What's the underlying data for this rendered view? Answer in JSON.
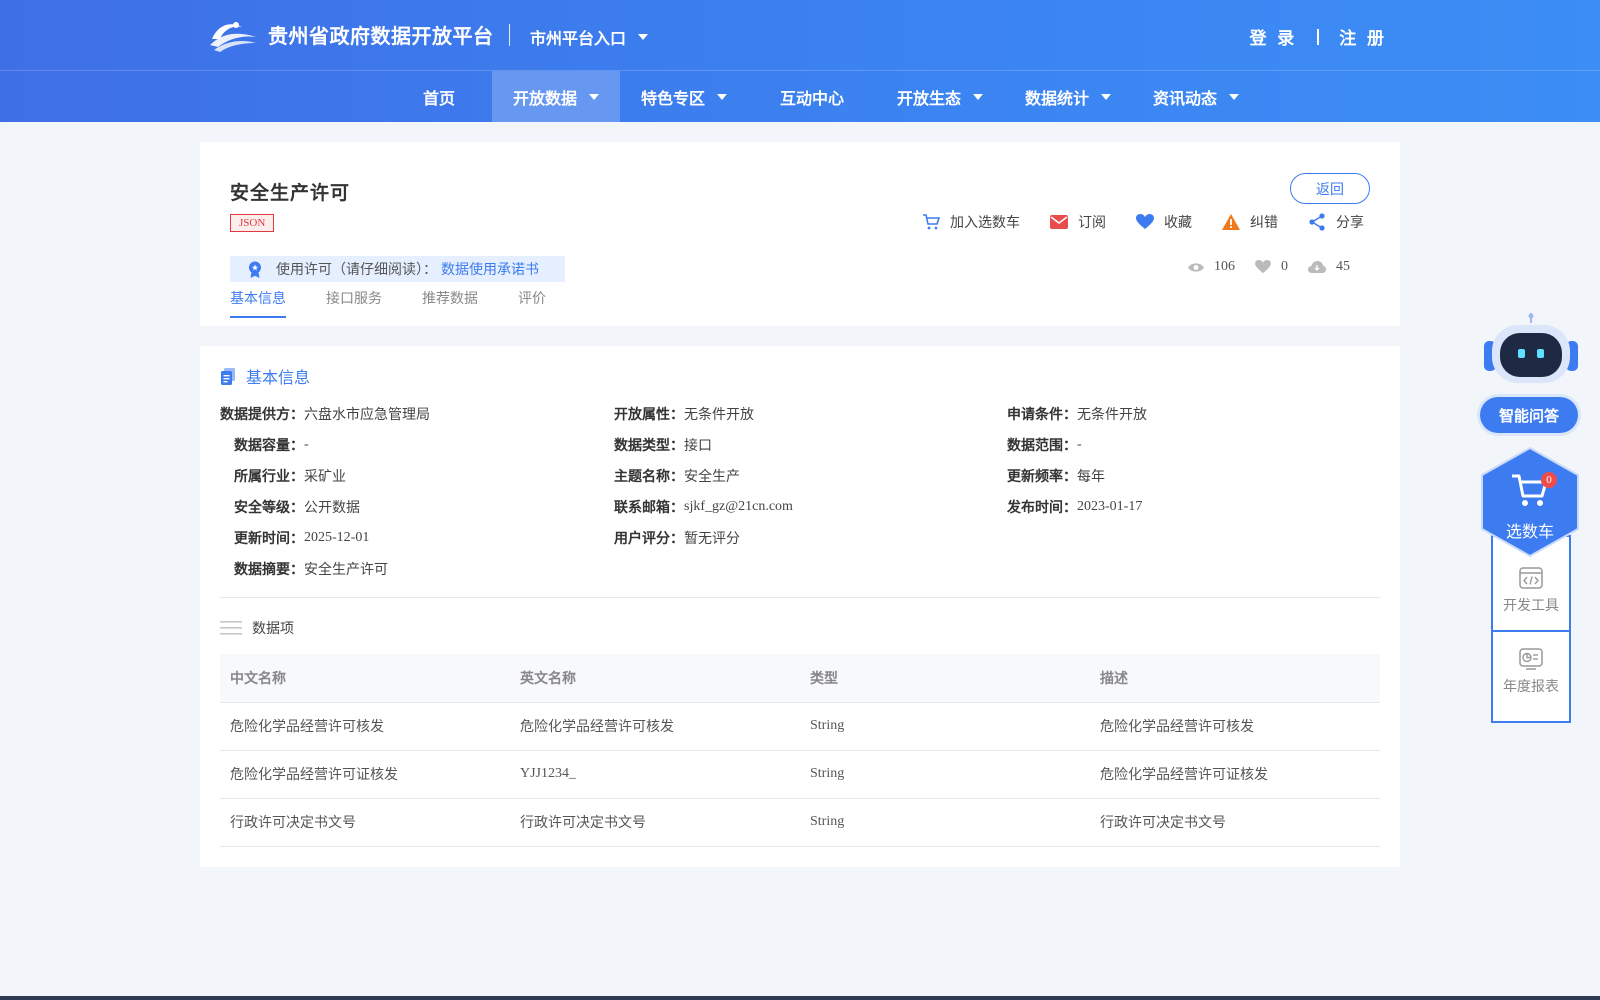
{
  "header": {
    "site_title": "贵州省政府数据开放平台",
    "city_entry": "市州平台入口",
    "login": "登 录",
    "register": "注 册"
  },
  "nav": {
    "items": [
      {
        "label": "首页",
        "dropdown": false,
        "active": false
      },
      {
        "label": "开放数据",
        "dropdown": true,
        "active": true
      },
      {
        "label": "特色专区",
        "dropdown": true,
        "active": false
      },
      {
        "label": "互动中心",
        "dropdown": false,
        "active": false
      },
      {
        "label": "开放生态",
        "dropdown": true,
        "active": false
      },
      {
        "label": "数据统计",
        "dropdown": true,
        "active": false
      },
      {
        "label": "资讯动态",
        "dropdown": true,
        "active": false
      }
    ]
  },
  "dataset": {
    "title": "安全生产许可",
    "format": "JSON",
    "back_label": "返回",
    "actions": {
      "cart": "加入选数车",
      "subscribe": "订阅",
      "favorite": "收藏",
      "report": "纠错",
      "share": "分享"
    },
    "license_prefix": "使用许可（请仔细阅读）：",
    "license_link": "数据使用承诺书",
    "stats": {
      "views": "106",
      "likes": "0",
      "downloads": "45"
    },
    "tabs": [
      "基本信息",
      "接口服务",
      "推荐数据",
      "评价"
    ]
  },
  "basic_info": {
    "section_title": "基本信息",
    "rows": [
      [
        {
          "k": "数据提供方：",
          "v": "六盘水市应急管理局"
        },
        {
          "k": "开放属性：",
          "v": "无条件开放"
        },
        {
          "k": "申请条件：",
          "v": "无条件开放"
        }
      ],
      [
        {
          "k": "数据容量：",
          "v": "-"
        },
        {
          "k": "数据类型：",
          "v": "接口"
        },
        {
          "k": "数据范围：",
          "v": "-"
        }
      ],
      [
        {
          "k": "所属行业：",
          "v": "采矿业"
        },
        {
          "k": "主题名称：",
          "v": "安全生产"
        },
        {
          "k": "更新频率：",
          "v": "每年"
        }
      ],
      [
        {
          "k": "安全等级：",
          "v": "公开数据"
        },
        {
          "k": "联系邮箱：",
          "v": "sjkf_gz@21cn.com"
        },
        {
          "k": "发布时间：",
          "v": "2023-01-17"
        }
      ],
      [
        {
          "k": "更新时间：",
          "v": "2025-12-01"
        },
        {
          "k": "用户评分：",
          "v": "暂无评分"
        }
      ],
      [
        {
          "k": "数据摘要：",
          "v": "安全生产许可"
        }
      ]
    ]
  },
  "data_items": {
    "section_title": "数据项",
    "columns": [
      "中文名称",
      "英文名称",
      "类型",
      "描述"
    ],
    "rows": [
      [
        "危险化学品经营许可核发",
        "危险化学品经营许可核发",
        "String",
        "危险化学品经营许可核发"
      ],
      [
        "危险化学品经营许可证核发",
        "YJJ1234_",
        "String",
        "危险化学品经营许可证核发"
      ],
      [
        "行政许可决定书文号",
        "行政许可决定书文号",
        "String",
        "行政许可决定书文号"
      ]
    ]
  },
  "sidebar": {
    "qa_label": "智能问答",
    "cart_label": "选数车",
    "cart_count": "0",
    "dev_tools": "开发工具",
    "annual_report": "年度报表"
  },
  "colors": {
    "primary": "#3d7cf0",
    "header_gradient_start": "#3f6fe6",
    "header_gradient_end": "#3c8df5",
    "format_badge": "#e0393e",
    "subscribe_icon": "#e84c4c",
    "report_icon": "#f07a1a"
  }
}
